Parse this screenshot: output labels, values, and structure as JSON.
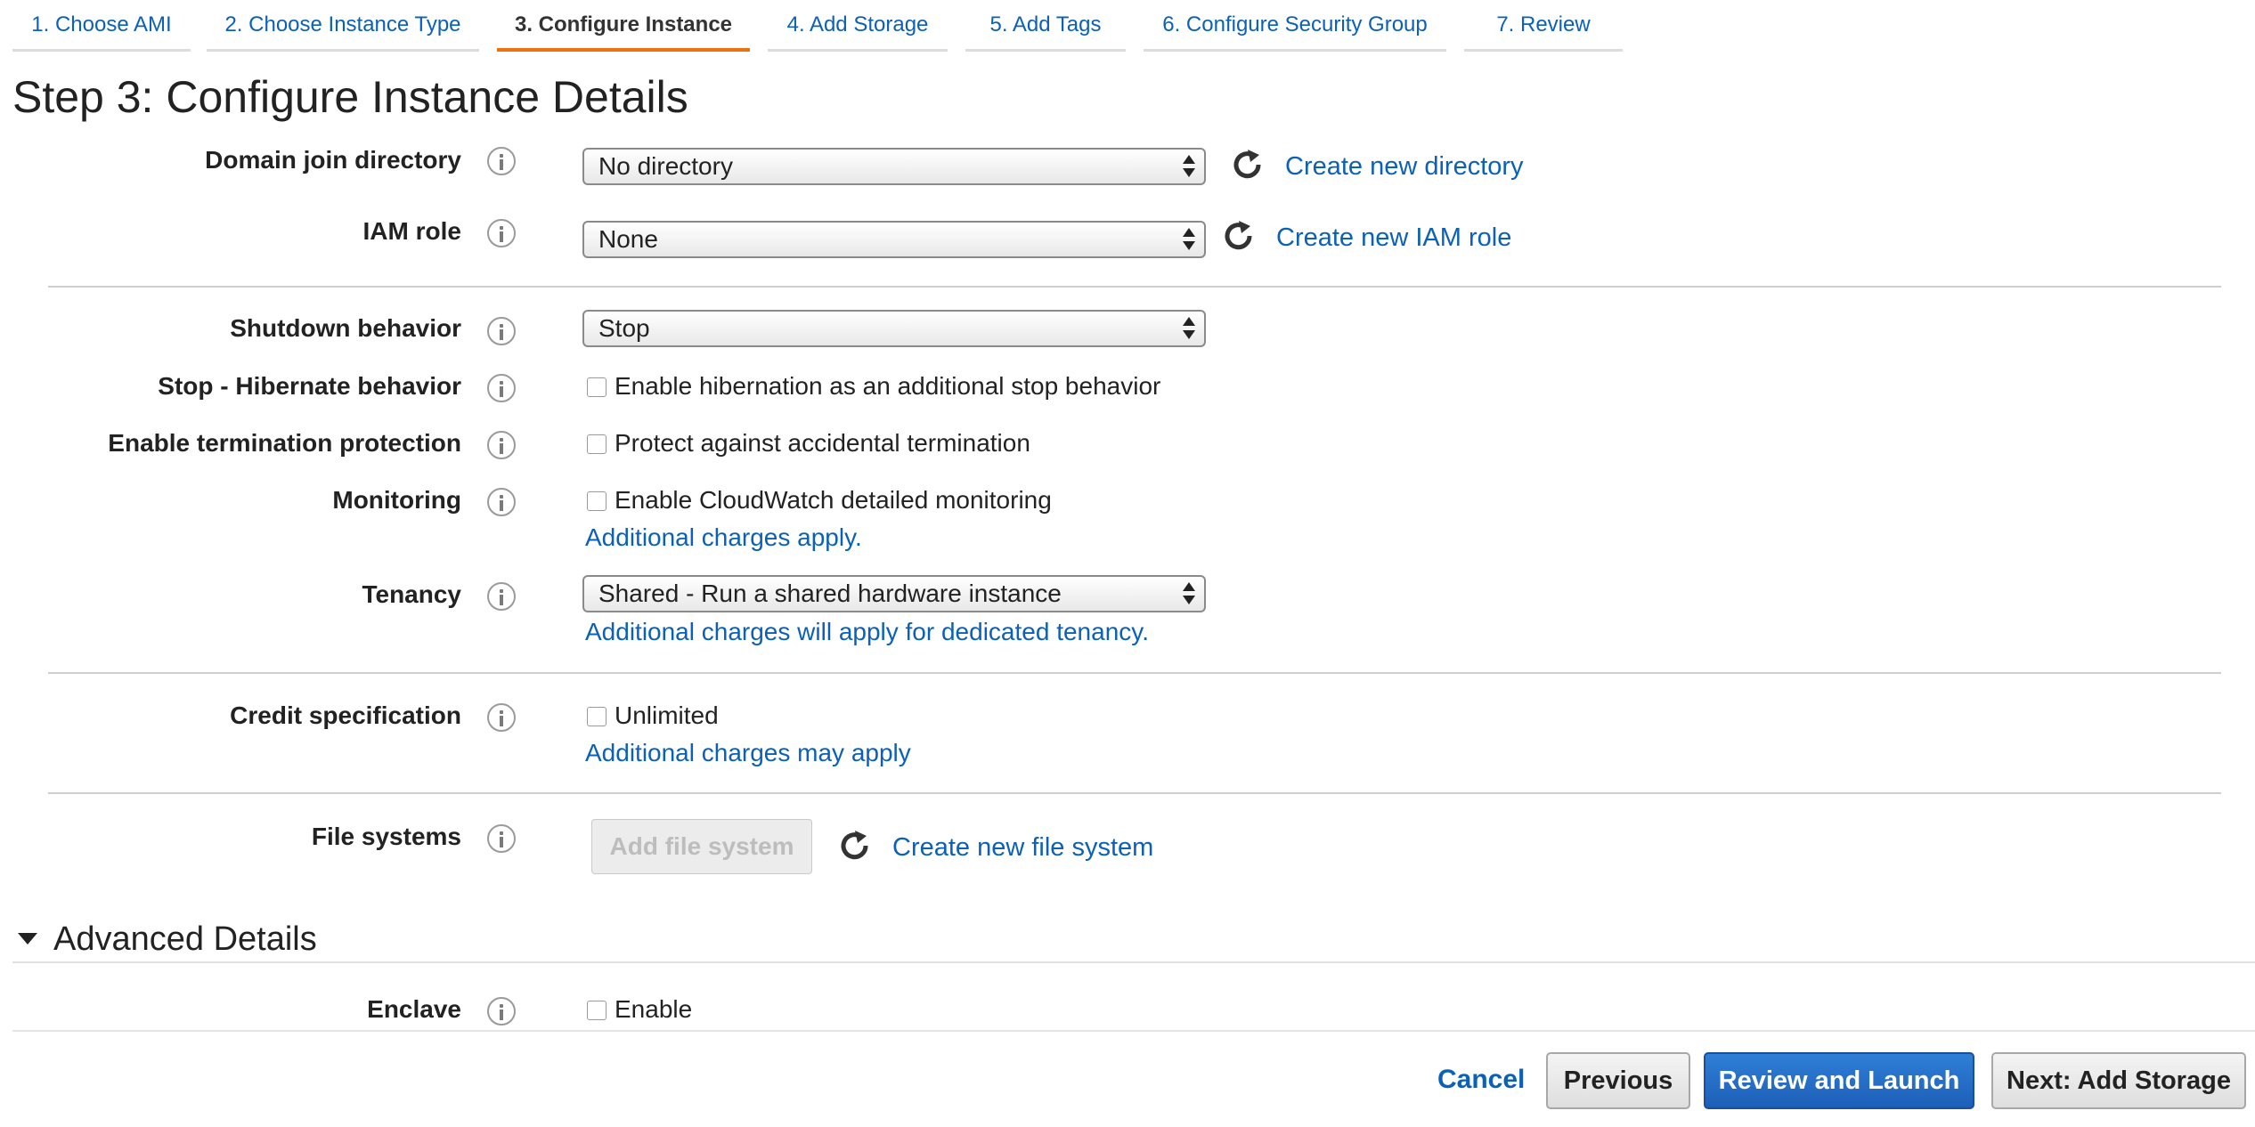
{
  "tabs": [
    {
      "label": "1. Choose AMI"
    },
    {
      "label": "2. Choose Instance Type"
    },
    {
      "label": "3. Configure Instance"
    },
    {
      "label": "4. Add Storage"
    },
    {
      "label": "5. Add Tags"
    },
    {
      "label": "6. Configure Security Group"
    },
    {
      "label": "7. Review"
    }
  ],
  "active_tab": "3. Configure Instance",
  "page_title": "Step 3: Configure Instance Details",
  "fields": {
    "domain": {
      "label": "Domain join directory",
      "value": "No directory",
      "link": "Create new directory"
    },
    "iam": {
      "label": "IAM role",
      "value": "None",
      "link": "Create new IAM role"
    },
    "shutdown": {
      "label": "Shutdown behavior",
      "value": "Stop"
    },
    "hibernate": {
      "label": "Stop - Hibernate behavior",
      "checkbox": "Enable hibernation as an additional stop behavior",
      "checked": false
    },
    "termination": {
      "label": "Enable termination protection",
      "checkbox": "Protect against accidental termination",
      "checked": false
    },
    "monitoring": {
      "label": "Monitoring",
      "checkbox": "Enable CloudWatch detailed monitoring",
      "checked": false,
      "note": "Additional charges apply."
    },
    "tenancy": {
      "label": "Tenancy",
      "value": "Shared - Run a shared hardware instance",
      "note": "Additional charges will apply for dedicated tenancy."
    },
    "credit": {
      "label": "Credit specification",
      "checkbox": "Unlimited",
      "checked": false,
      "note": "Additional charges may apply"
    },
    "filesystems": {
      "label": "File systems",
      "button": "Add file system",
      "link": "Create new file system"
    }
  },
  "advanced": {
    "heading": "Advanced Details",
    "enclave": {
      "label": "Enclave",
      "checkbox": "Enable",
      "checked": false
    }
  },
  "footer": {
    "cancel": "Cancel",
    "previous": "Previous",
    "review_launch": "Review and Launch",
    "next": "Next: Add Storage"
  },
  "colors": {
    "link": "#0b61b8",
    "active_tab_underline": "#ec7211",
    "primary_button": "#1d5fb8"
  }
}
